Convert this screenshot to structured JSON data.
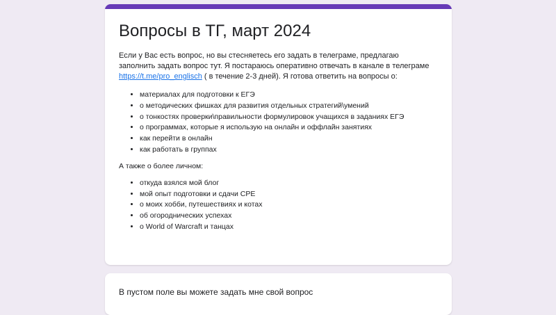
{
  "form": {
    "title": "Вопросы в ТГ, март 2024",
    "description_before_link": "Если у Вас есть вопрос, но вы стесняетесь его задать в телеграме, предлагаю заполнить задать вопрос тут. Я постараюсь оперативно отвечать в канале в телеграме ",
    "link_text": "https://t.me/pro_englisch",
    "description_after_link": " ( в течение 2-3 дней). Я готова ответить на вопросы о:",
    "topics": [
      "материалах для подготовки к ЕГЭ",
      "о методических фишках для развития отдельных стратегий\\умений",
      "о тонкостях проверки\\правильности формулировок учащихся в заданиях ЕГЭ",
      "о программах, которые я использую на онлайн и оффлайн занятиях",
      "как перейти в онлайн",
      "как работать в группах"
    ],
    "also_label": "А также о более личном:",
    "personal_topics": [
      "откуда взялся мой блог",
      "мой опыт подготовки и сдачи CPE",
      "о моих хобби, путешествиях и котах",
      "об огороднических успехах",
      "о World of Warcraft и танцах"
    ]
  },
  "question": {
    "label": "В пустом поле вы можете задать мне свой вопрос"
  },
  "colors": {
    "accent": "#673ab7",
    "background": "#efeaf3",
    "link": "#1a73e8"
  }
}
